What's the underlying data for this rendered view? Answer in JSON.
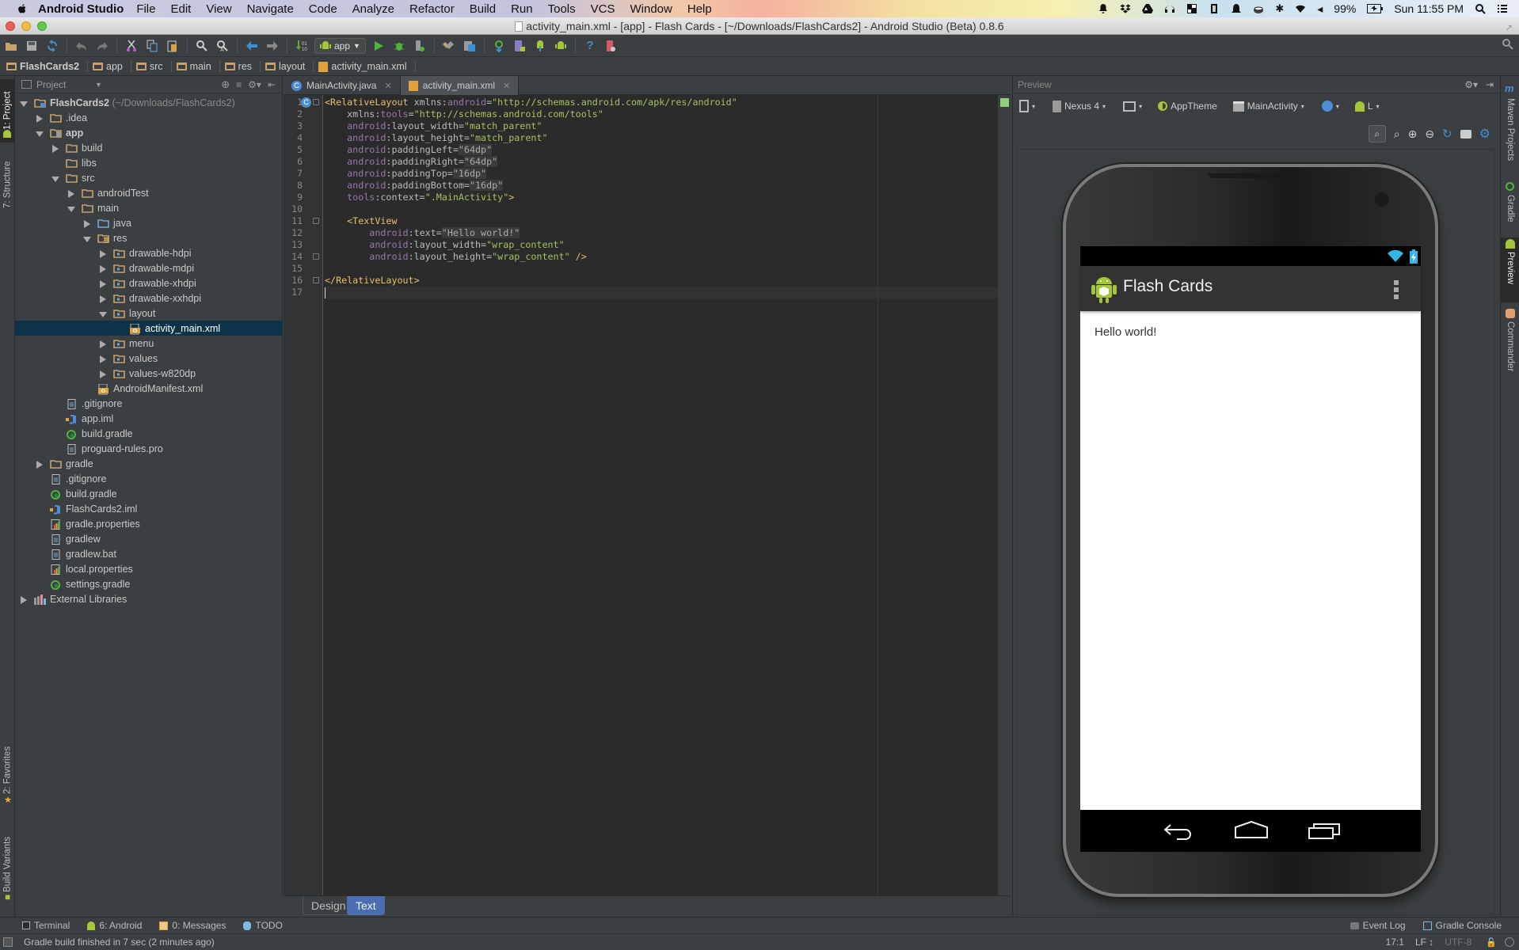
{
  "menubar": {
    "app_name": "Android Studio",
    "items": [
      "File",
      "Edit",
      "View",
      "Navigate",
      "Code",
      "Analyze",
      "Refactor",
      "Build",
      "Run",
      "Tools",
      "VCS",
      "Window",
      "Help"
    ],
    "battery": "99%",
    "clock": "Sun 11:55 PM"
  },
  "window": {
    "title": "activity_main.xml - [app] - Flash Cards - [~/Downloads/FlashCards2] - Android Studio (Beta) 0.8.6"
  },
  "toolbar": {
    "run_config": "app"
  },
  "breadcrumb": [
    "FlashCards2",
    "app",
    "src",
    "main",
    "res",
    "layout",
    "activity_main.xml"
  ],
  "left_strip": {
    "project_tab": "1: Project",
    "structure_tab": "7: Structure",
    "favorites_tab": "2: Favorites",
    "build_variants_tab": "Build Variants"
  },
  "project_panel": {
    "view_mode": "Project",
    "tree": [
      {
        "label": "FlashCards2",
        "suffix": " (~/Downloads/FlashCards2)",
        "depth": 0,
        "expanded": true,
        "icon": "module",
        "bold": true
      },
      {
        "label": ".idea",
        "depth": 1,
        "expanded": false,
        "icon": "folder"
      },
      {
        "label": "app",
        "depth": 1,
        "expanded": true,
        "icon": "android-module",
        "bold": true
      },
      {
        "label": "build",
        "depth": 2,
        "expanded": false,
        "icon": "folder"
      },
      {
        "label": "libs",
        "depth": 2,
        "icon": "folder"
      },
      {
        "label": "src",
        "depth": 2,
        "expanded": true,
        "icon": "folder"
      },
      {
        "label": "androidTest",
        "depth": 3,
        "expanded": false,
        "icon": "folder"
      },
      {
        "label": "main",
        "depth": 3,
        "expanded": true,
        "icon": "folder"
      },
      {
        "label": "java",
        "depth": 4,
        "expanded": false,
        "icon": "source-folder"
      },
      {
        "label": "res",
        "depth": 4,
        "expanded": true,
        "icon": "res-folder"
      },
      {
        "label": "drawable-hdpi",
        "depth": 5,
        "expanded": false,
        "icon": "package"
      },
      {
        "label": "drawable-mdpi",
        "depth": 5,
        "expanded": false,
        "icon": "package"
      },
      {
        "label": "drawable-xhdpi",
        "depth": 5,
        "expanded": false,
        "icon": "package"
      },
      {
        "label": "drawable-xxhdpi",
        "depth": 5,
        "expanded": false,
        "icon": "package"
      },
      {
        "label": "layout",
        "depth": 5,
        "expanded": true,
        "icon": "package"
      },
      {
        "label": "activity_main.xml",
        "depth": 6,
        "icon": "xml-file",
        "selected": true
      },
      {
        "label": "menu",
        "depth": 5,
        "expanded": false,
        "icon": "package"
      },
      {
        "label": "values",
        "depth": 5,
        "expanded": false,
        "icon": "package"
      },
      {
        "label": "values-w820dp",
        "depth": 5,
        "expanded": false,
        "icon": "package"
      },
      {
        "label": "AndroidManifest.xml",
        "depth": 4,
        "icon": "xml-file"
      },
      {
        "label": ".gitignore",
        "depth": 2,
        "icon": "text-file"
      },
      {
        "label": "app.iml",
        "depth": 2,
        "icon": "iml-file"
      },
      {
        "label": "build.gradle",
        "depth": 2,
        "icon": "gradle-file"
      },
      {
        "label": "proguard-rules.pro",
        "depth": 2,
        "icon": "text-file"
      },
      {
        "label": "gradle",
        "depth": 1,
        "expanded": false,
        "icon": "folder"
      },
      {
        "label": ".gitignore",
        "depth": 1,
        "icon": "text-file"
      },
      {
        "label": "build.gradle",
        "depth": 1,
        "icon": "gradle-file"
      },
      {
        "label": "FlashCards2.iml",
        "depth": 1,
        "icon": "iml-file"
      },
      {
        "label": "gradle.properties",
        "depth": 1,
        "icon": "properties-file"
      },
      {
        "label": "gradlew",
        "depth": 1,
        "icon": "text-file"
      },
      {
        "label": "gradlew.bat",
        "depth": 1,
        "icon": "text-file"
      },
      {
        "label": "local.properties",
        "depth": 1,
        "icon": "properties-file"
      },
      {
        "label": "settings.gradle",
        "depth": 1,
        "icon": "gradle-file"
      },
      {
        "label": "External Libraries",
        "depth": 0,
        "expanded": false,
        "icon": "libraries"
      }
    ]
  },
  "editor": {
    "tabs": [
      {
        "label": "MainActivity.java",
        "icon": "java-class",
        "active": false
      },
      {
        "label": "activity_main.xml",
        "icon": "xml-file",
        "active": true
      }
    ],
    "lines": [
      [
        {
          "t": "tag",
          "v": "<RelativeLayout "
        },
        {
          "t": "attr",
          "v": "xmlns:"
        },
        {
          "t": "ns",
          "v": "android"
        },
        {
          "t": "attr",
          "v": "="
        },
        {
          "t": "str",
          "v": "\"http://schemas.android.com/apk/res/android\""
        }
      ],
      [
        {
          "t": "attr",
          "v": "    xmlns:"
        },
        {
          "t": "ns",
          "v": "tools"
        },
        {
          "t": "attr",
          "v": "="
        },
        {
          "t": "str",
          "v": "\"http://schemas.android.com/tools\""
        }
      ],
      [
        {
          "t": "ns",
          "v": "    android"
        },
        {
          "t": "attr",
          "v": ":layout_width="
        },
        {
          "t": "str",
          "v": "\"match_parent\""
        }
      ],
      [
        {
          "t": "ns",
          "v": "    android"
        },
        {
          "t": "attr",
          "v": ":layout_height="
        },
        {
          "t": "str",
          "v": "\"match_parent\""
        }
      ],
      [
        {
          "t": "ns",
          "v": "    android"
        },
        {
          "t": "attr",
          "v": ":paddingLeft="
        },
        {
          "t": "grey",
          "v": "\"64dp\""
        }
      ],
      [
        {
          "t": "ns",
          "v": "    android"
        },
        {
          "t": "attr",
          "v": ":paddingRight="
        },
        {
          "t": "grey",
          "v": "\"64dp\""
        }
      ],
      [
        {
          "t": "ns",
          "v": "    android"
        },
        {
          "t": "attr",
          "v": ":paddingTop="
        },
        {
          "t": "grey",
          "v": "\"16dp\""
        }
      ],
      [
        {
          "t": "ns",
          "v": "    android"
        },
        {
          "t": "attr",
          "v": ":paddingBottom="
        },
        {
          "t": "grey",
          "v": "\"16dp\""
        }
      ],
      [
        {
          "t": "ns",
          "v": "    tools"
        },
        {
          "t": "attr",
          "v": ":context="
        },
        {
          "t": "str",
          "v": "\".MainActivity\""
        },
        {
          "t": "tag",
          "v": ">"
        }
      ],
      [],
      [
        {
          "t": "tag",
          "v": "    <TextView"
        }
      ],
      [
        {
          "t": "ns",
          "v": "        android"
        },
        {
          "t": "attr",
          "v": ":text="
        },
        {
          "t": "grey",
          "v": "\"Hello world!\""
        }
      ],
      [
        {
          "t": "ns",
          "v": "        android"
        },
        {
          "t": "attr",
          "v": ":layout_width="
        },
        {
          "t": "str",
          "v": "\"wrap_content\""
        }
      ],
      [
        {
          "t": "ns",
          "v": "        android"
        },
        {
          "t": "attr",
          "v": ":layout_height="
        },
        {
          "t": "str",
          "v": "\"wrap_content\""
        },
        {
          "t": "tag",
          "v": " />"
        }
      ],
      [],
      [
        {
          "t": "tag",
          "v": "</RelativeLayout>"
        }
      ],
      []
    ],
    "bottom_tabs": [
      "Design",
      "Text"
    ],
    "active_bottom_tab": "Text"
  },
  "preview": {
    "title": "Preview",
    "device": "Nexus 4",
    "theme": "AppTheme",
    "activity": "MainActivity",
    "api_level": "L",
    "app_title": "Flash Cards",
    "content_text": "Hello world!"
  },
  "right_strip": {
    "tabs": [
      "Maven Projects",
      "Gradle",
      "Preview",
      "Commander"
    ]
  },
  "bottom_tools": {
    "left": [
      {
        "label": "Terminal",
        "icon": "terminal-icon"
      },
      {
        "label": "6: Android",
        "icon": "android-icon"
      },
      {
        "label": "0: Messages",
        "icon": "messages-icon"
      },
      {
        "label": "TODO",
        "icon": "todo-icon"
      }
    ],
    "right": [
      {
        "label": "Event Log",
        "icon": "event-log-icon"
      },
      {
        "label": "Gradle Console",
        "icon": "gradle-console-icon"
      }
    ]
  },
  "status_bar": {
    "message": "Gradle build finished in 7 sec (2 minutes ago)",
    "caret": "17:1",
    "line_separator": "LF",
    "encoding": "UTF-8"
  },
  "colors": {
    "accent_blue": "#4b6eaf",
    "selection": "#0d3349",
    "android_green": "#a4c639",
    "folder": "#c7a16e"
  }
}
